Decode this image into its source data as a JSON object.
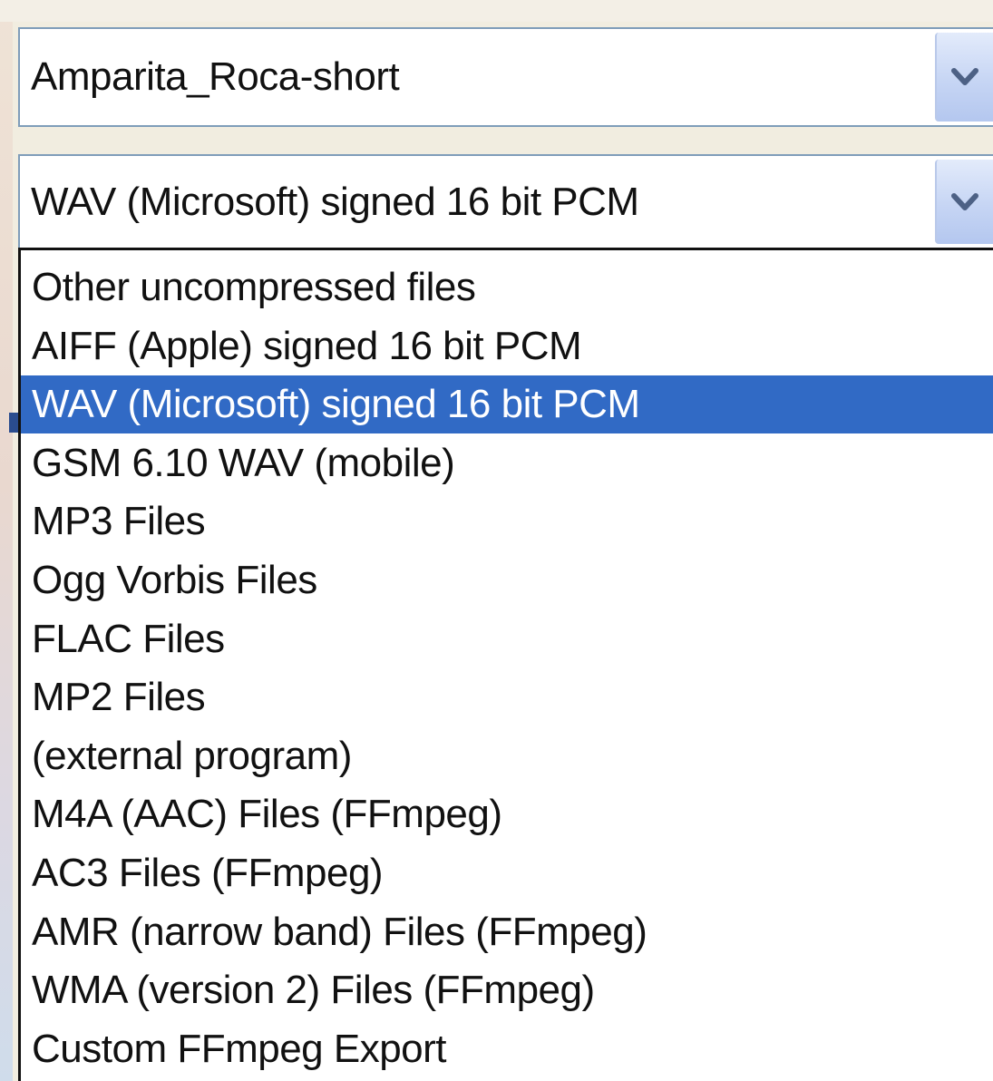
{
  "project_combo": {
    "value": "Amparita_Roca-short"
  },
  "format_combo": {
    "value": "WAV (Microsoft) signed 16 bit PCM"
  },
  "format_dropdown": {
    "selected_index": 2,
    "items": [
      "Other uncompressed files",
      "AIFF (Apple) signed 16 bit PCM",
      "WAV (Microsoft) signed 16 bit PCM",
      "GSM 6.10 WAV (mobile)",
      "MP3 Files",
      "Ogg Vorbis Files",
      "FLAC Files",
      "MP2 Files",
      "(external program)",
      "M4A (AAC) Files (FFmpeg)",
      "AC3 Files (FFmpeg)",
      "AMR (narrow band) Files (FFmpeg)",
      "WMA (version 2) Files (FFmpeg)",
      "Custom FFmpeg Export"
    ]
  },
  "icons": {
    "dropdown_arrow": "chevron-down-icon"
  },
  "colors": {
    "selection": "#316ac5",
    "combo_border": "#7f9db9",
    "button_face": "#c6d5f4",
    "arrow": "#4d6185"
  }
}
